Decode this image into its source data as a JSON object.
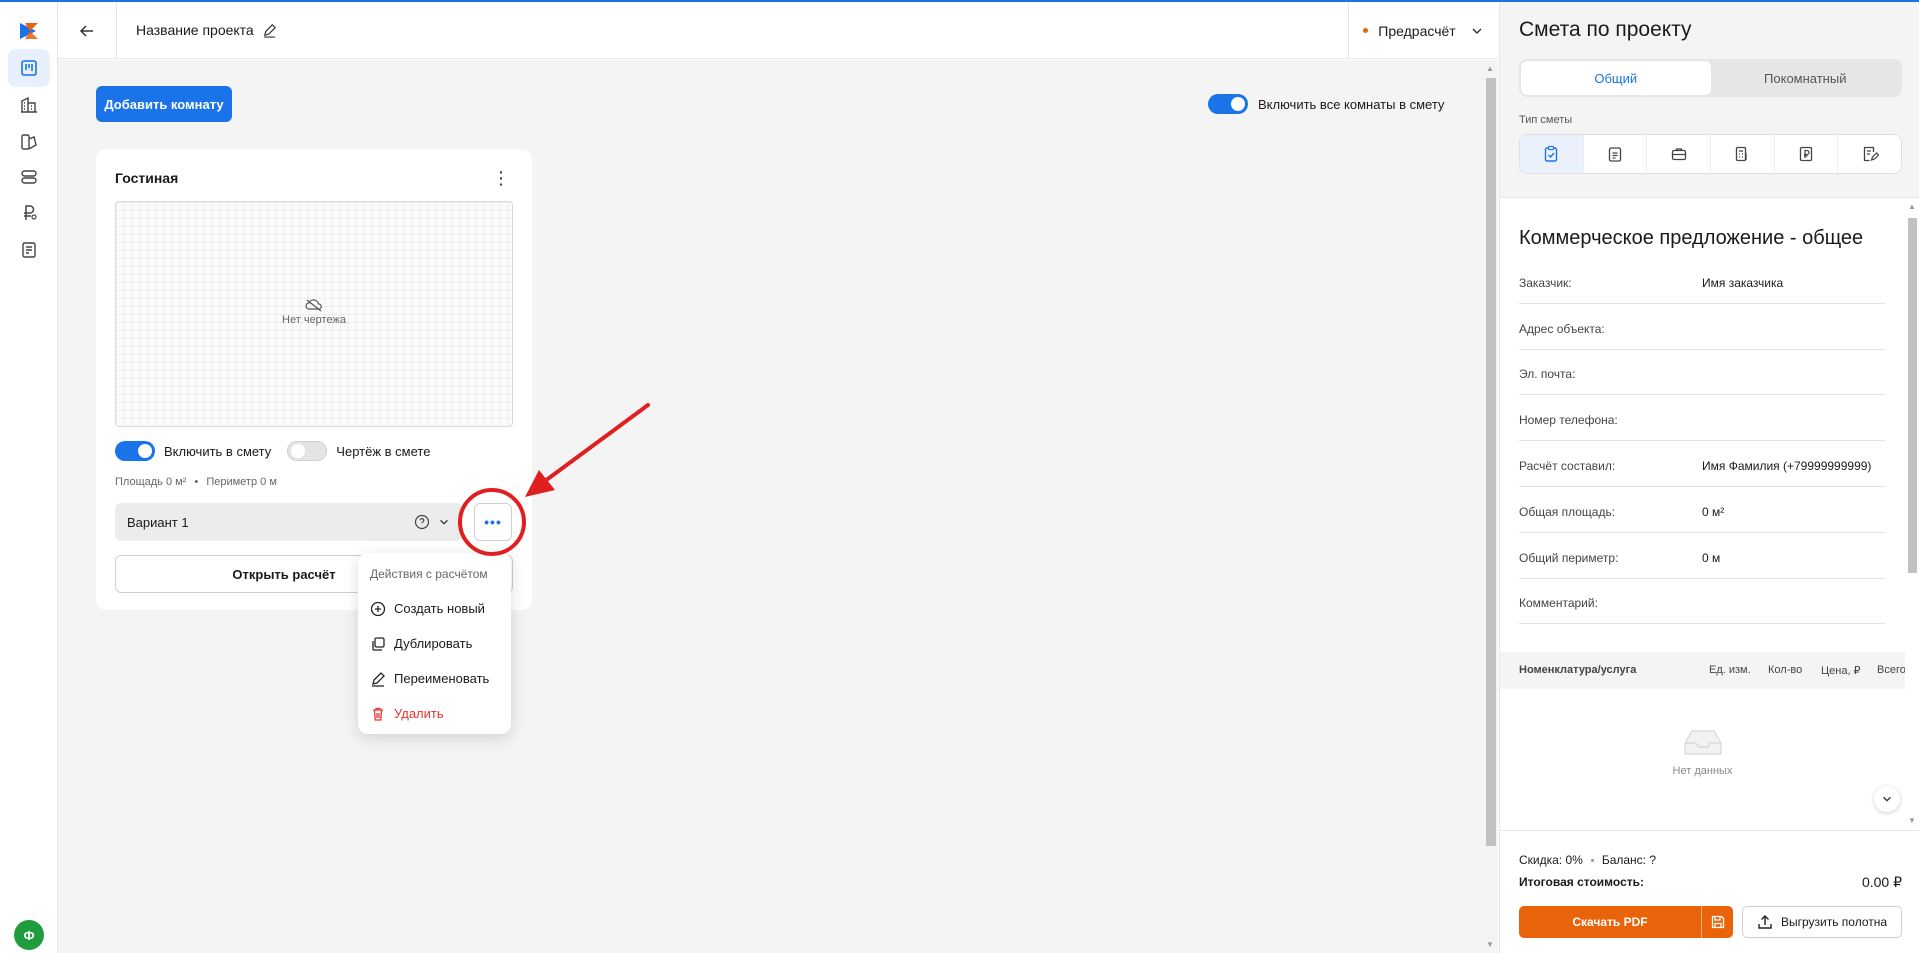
{
  "header": {
    "project_name": "Название проекта",
    "stage": "Предрасчёт"
  },
  "main": {
    "add_room_label": "Добавить комнату",
    "include_all_label": "Включить все комнаты в смету",
    "room": {
      "title": "Гостиная",
      "no_drawing": "Нет чертежа",
      "include_label": "Включить в смету",
      "drawing_label": "Чертёж в смете",
      "area": "Площадь 0 м²",
      "perimeter": "Периметр 0 м",
      "variant": "Вариант 1",
      "open_label": "Открыть расчёт"
    },
    "menu": {
      "heading": "Действия с расчётом",
      "items": [
        "Создать новый",
        "Дублировать",
        "Переименовать",
        "Удалить"
      ]
    }
  },
  "user": {
    "initial": "Ф"
  },
  "panel": {
    "title": "Смета по проекту",
    "tabs": [
      "Общий",
      "Покомнатный"
    ],
    "type_label": "Тип сметы",
    "offer_title": "Коммерческое предложение - общее",
    "fields": [
      {
        "k": "Заказчик:",
        "v": "Имя заказчика"
      },
      {
        "k": "Адрес объекта:",
        "v": ""
      },
      {
        "k": "Эл. почта:",
        "v": ""
      },
      {
        "k": "Номер телефона:",
        "v": ""
      },
      {
        "k": "Расчёт составил:",
        "v": "Имя Фамилия (+79999999999)"
      },
      {
        "k": "Общая площадь:",
        "v": "0 м²"
      },
      {
        "k": "Общий периметр:",
        "v": "0 м"
      },
      {
        "k": "Комментарий:",
        "v": ""
      }
    ],
    "table_headers": [
      "Номенклатура/услуга",
      "Ед. изм.",
      "Кол-во",
      "Цена, ₽",
      "Всего"
    ],
    "no_data": "Нет данных",
    "discount": "Скидка: 0%",
    "balance": "Баланс: ?",
    "total_label": "Итоговая стоимость:",
    "total_value": "0.00 ₽",
    "pdf_label": "Скачать PDF",
    "export_label": "Выгрузить полотна"
  },
  "colors": {
    "accent": "#1a73e8",
    "orange": "#e8630a",
    "danger": "#e3342f",
    "annotation": "#e02020"
  }
}
